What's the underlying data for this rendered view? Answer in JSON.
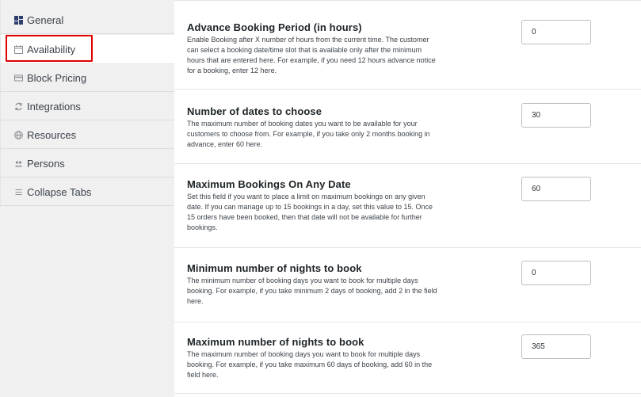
{
  "sidebar": {
    "tabs": [
      {
        "label": "General",
        "icon": "general-grid-icon",
        "active": false
      },
      {
        "label": "Availability",
        "icon": "calendar-icon",
        "active": true
      },
      {
        "label": "Block Pricing",
        "icon": "block-pricing-icon",
        "active": false
      },
      {
        "label": "Integrations",
        "icon": "sync-icon",
        "active": false
      },
      {
        "label": "Resources",
        "icon": "globe-icon",
        "active": false
      },
      {
        "label": "Persons",
        "icon": "persons-icon",
        "active": false
      },
      {
        "label": "Collapse Tabs",
        "icon": "collapse-icon",
        "active": false
      }
    ]
  },
  "settings": [
    {
      "title": "Advance Booking Period (in hours)",
      "description": "Enable Booking after X number of hours from the current time. The customer can select a booking date/time slot that is available only after the minimum hours that are entered here. For example, if you need 12 hours advance notice for a booking, enter 12 here.",
      "value": "0"
    },
    {
      "title": "Number of dates to choose",
      "description": "The maximum number of booking dates you want to be available for your customers to choose from. For example, if you take only 2 months booking in advance, enter 60 here.",
      "value": "30"
    },
    {
      "title": "Maximum Bookings On Any Date",
      "description": "Set this field if you want to place a limit on maximum bookings on any given date. If you can manage up to 15 bookings in a day, set this value to 15. Once 15 orders have been booked, then that date will not be available for further bookings.",
      "value": "60"
    },
    {
      "title": "Minimum number of nights to book",
      "description": "The minimum number of booking days you want to book for multiple days booking. For example, if you take minimum 2 days of booking, add 2 in the field here.",
      "value": "0"
    },
    {
      "title": "Maximum number of nights to book",
      "description": "The maximum number of booking days you want to book for multiple days booking. For example, if you take maximum 60 days of booking, add 60 in the field here.",
      "value": "365"
    }
  ],
  "colors": {
    "highlight": "#e00000",
    "icon_general": "#2c3e6b",
    "sidebar_bg": "#f0f0f1"
  }
}
